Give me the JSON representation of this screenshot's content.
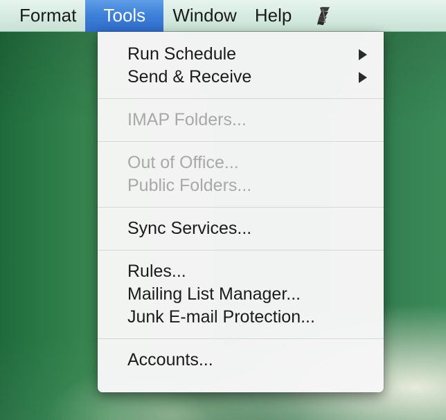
{
  "menubar": {
    "items": [
      {
        "label": "Format"
      },
      {
        "label": "Tools"
      },
      {
        "label": "Window"
      },
      {
        "label": "Help"
      }
    ],
    "script_icon": "applescript-icon"
  },
  "tools_menu": {
    "run_schedule": "Run Schedule",
    "send_receive": "Send & Receive",
    "imap_folders": "IMAP Folders...",
    "out_of_office": "Out of Office...",
    "public_folders": "Public Folders...",
    "sync_services": "Sync Services...",
    "rules": "Rules...",
    "mailing_list_manager": "Mailing List Manager...",
    "junk_email_protection": "Junk E-mail Protection...",
    "accounts": "Accounts..."
  },
  "colors": {
    "menubar_highlight": "#3d7fd8",
    "disabled_text": "#a8a8a8",
    "desktop_green": "#2a7a46"
  }
}
